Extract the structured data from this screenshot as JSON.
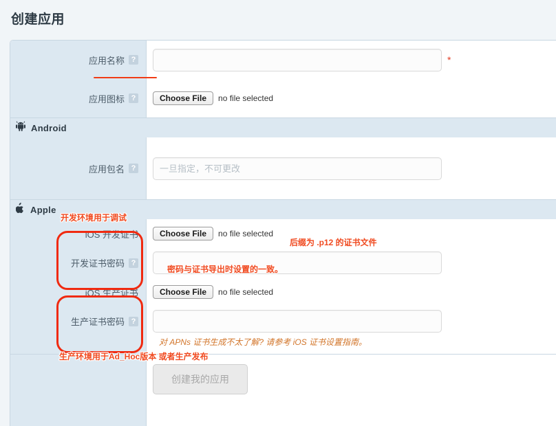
{
  "page": {
    "title": "创建应用"
  },
  "form": {
    "sections": [
      {
        "id": "basic",
        "rows": [
          {
            "id": "app-name",
            "label": "应用名称",
            "help": "?",
            "control": "text",
            "value": "",
            "placeholder": "",
            "required_mark": "*"
          },
          {
            "id": "app-icon",
            "label": "应用图标",
            "help": "?",
            "control": "file",
            "button_label": "Choose File",
            "status": "no file selected"
          }
        ]
      },
      {
        "id": "android",
        "platform": {
          "name": "Android",
          "icon": "android-icon"
        },
        "rows": [
          {
            "id": "package-name",
            "label": "应用包名",
            "help": "?",
            "control": "text",
            "value": "",
            "placeholder": "一旦指定，不可更改"
          }
        ]
      },
      {
        "id": "apple",
        "platform": {
          "name": "Apple",
          "icon": "apple-icon"
        },
        "rows": [
          {
            "id": "ios-dev-cert",
            "label": "iOS 开发证书",
            "control": "file",
            "button_label": "Choose File",
            "status": "no file selected"
          },
          {
            "id": "ios-dev-cert-password",
            "label": "开发证书密码",
            "help": "?",
            "control": "text",
            "value": "",
            "placeholder": ""
          },
          {
            "id": "ios-prod-cert",
            "label": "iOS 生产证书",
            "control": "file",
            "button_label": "Choose File",
            "status": "no file selected"
          },
          {
            "id": "ios-prod-cert-password",
            "label": "生产证书密码",
            "help": "?",
            "control": "text",
            "value": "",
            "placeholder": ""
          }
        ],
        "hint": {
          "text": "对 APNs 证书生成不太了解? 请参考 ",
          "link_text": "iOS 证书设置指南",
          "suffix": "。"
        }
      },
      {
        "id": "submit",
        "rows": [
          {
            "id": "create-app",
            "label": "",
            "control": "button",
            "button_label": "创建我的应用",
            "disabled": true
          }
        ]
      }
    ]
  },
  "annotations": {
    "texts": [
      {
        "id": "dev-env-note",
        "text": "开发环境用于调试"
      },
      {
        "id": "p12-note",
        "text": "后缀为 .p12 的证书文件"
      },
      {
        "id": "password-note",
        "text": "密码与证书导出时设置的一致。"
      },
      {
        "id": "prod-env-note",
        "text": "生产环境用于Ad_Hoc版本 或者生产发布"
      }
    ]
  },
  "colors": {
    "page_background": "#f1f5f8",
    "label_column": "#dce8f1",
    "panel_border": "#c8d7e2",
    "annotation_red": "#f04a20",
    "annotation_box_red": "#f02a10",
    "required_red": "#e23b23",
    "hint_orange": "#d2752a"
  }
}
